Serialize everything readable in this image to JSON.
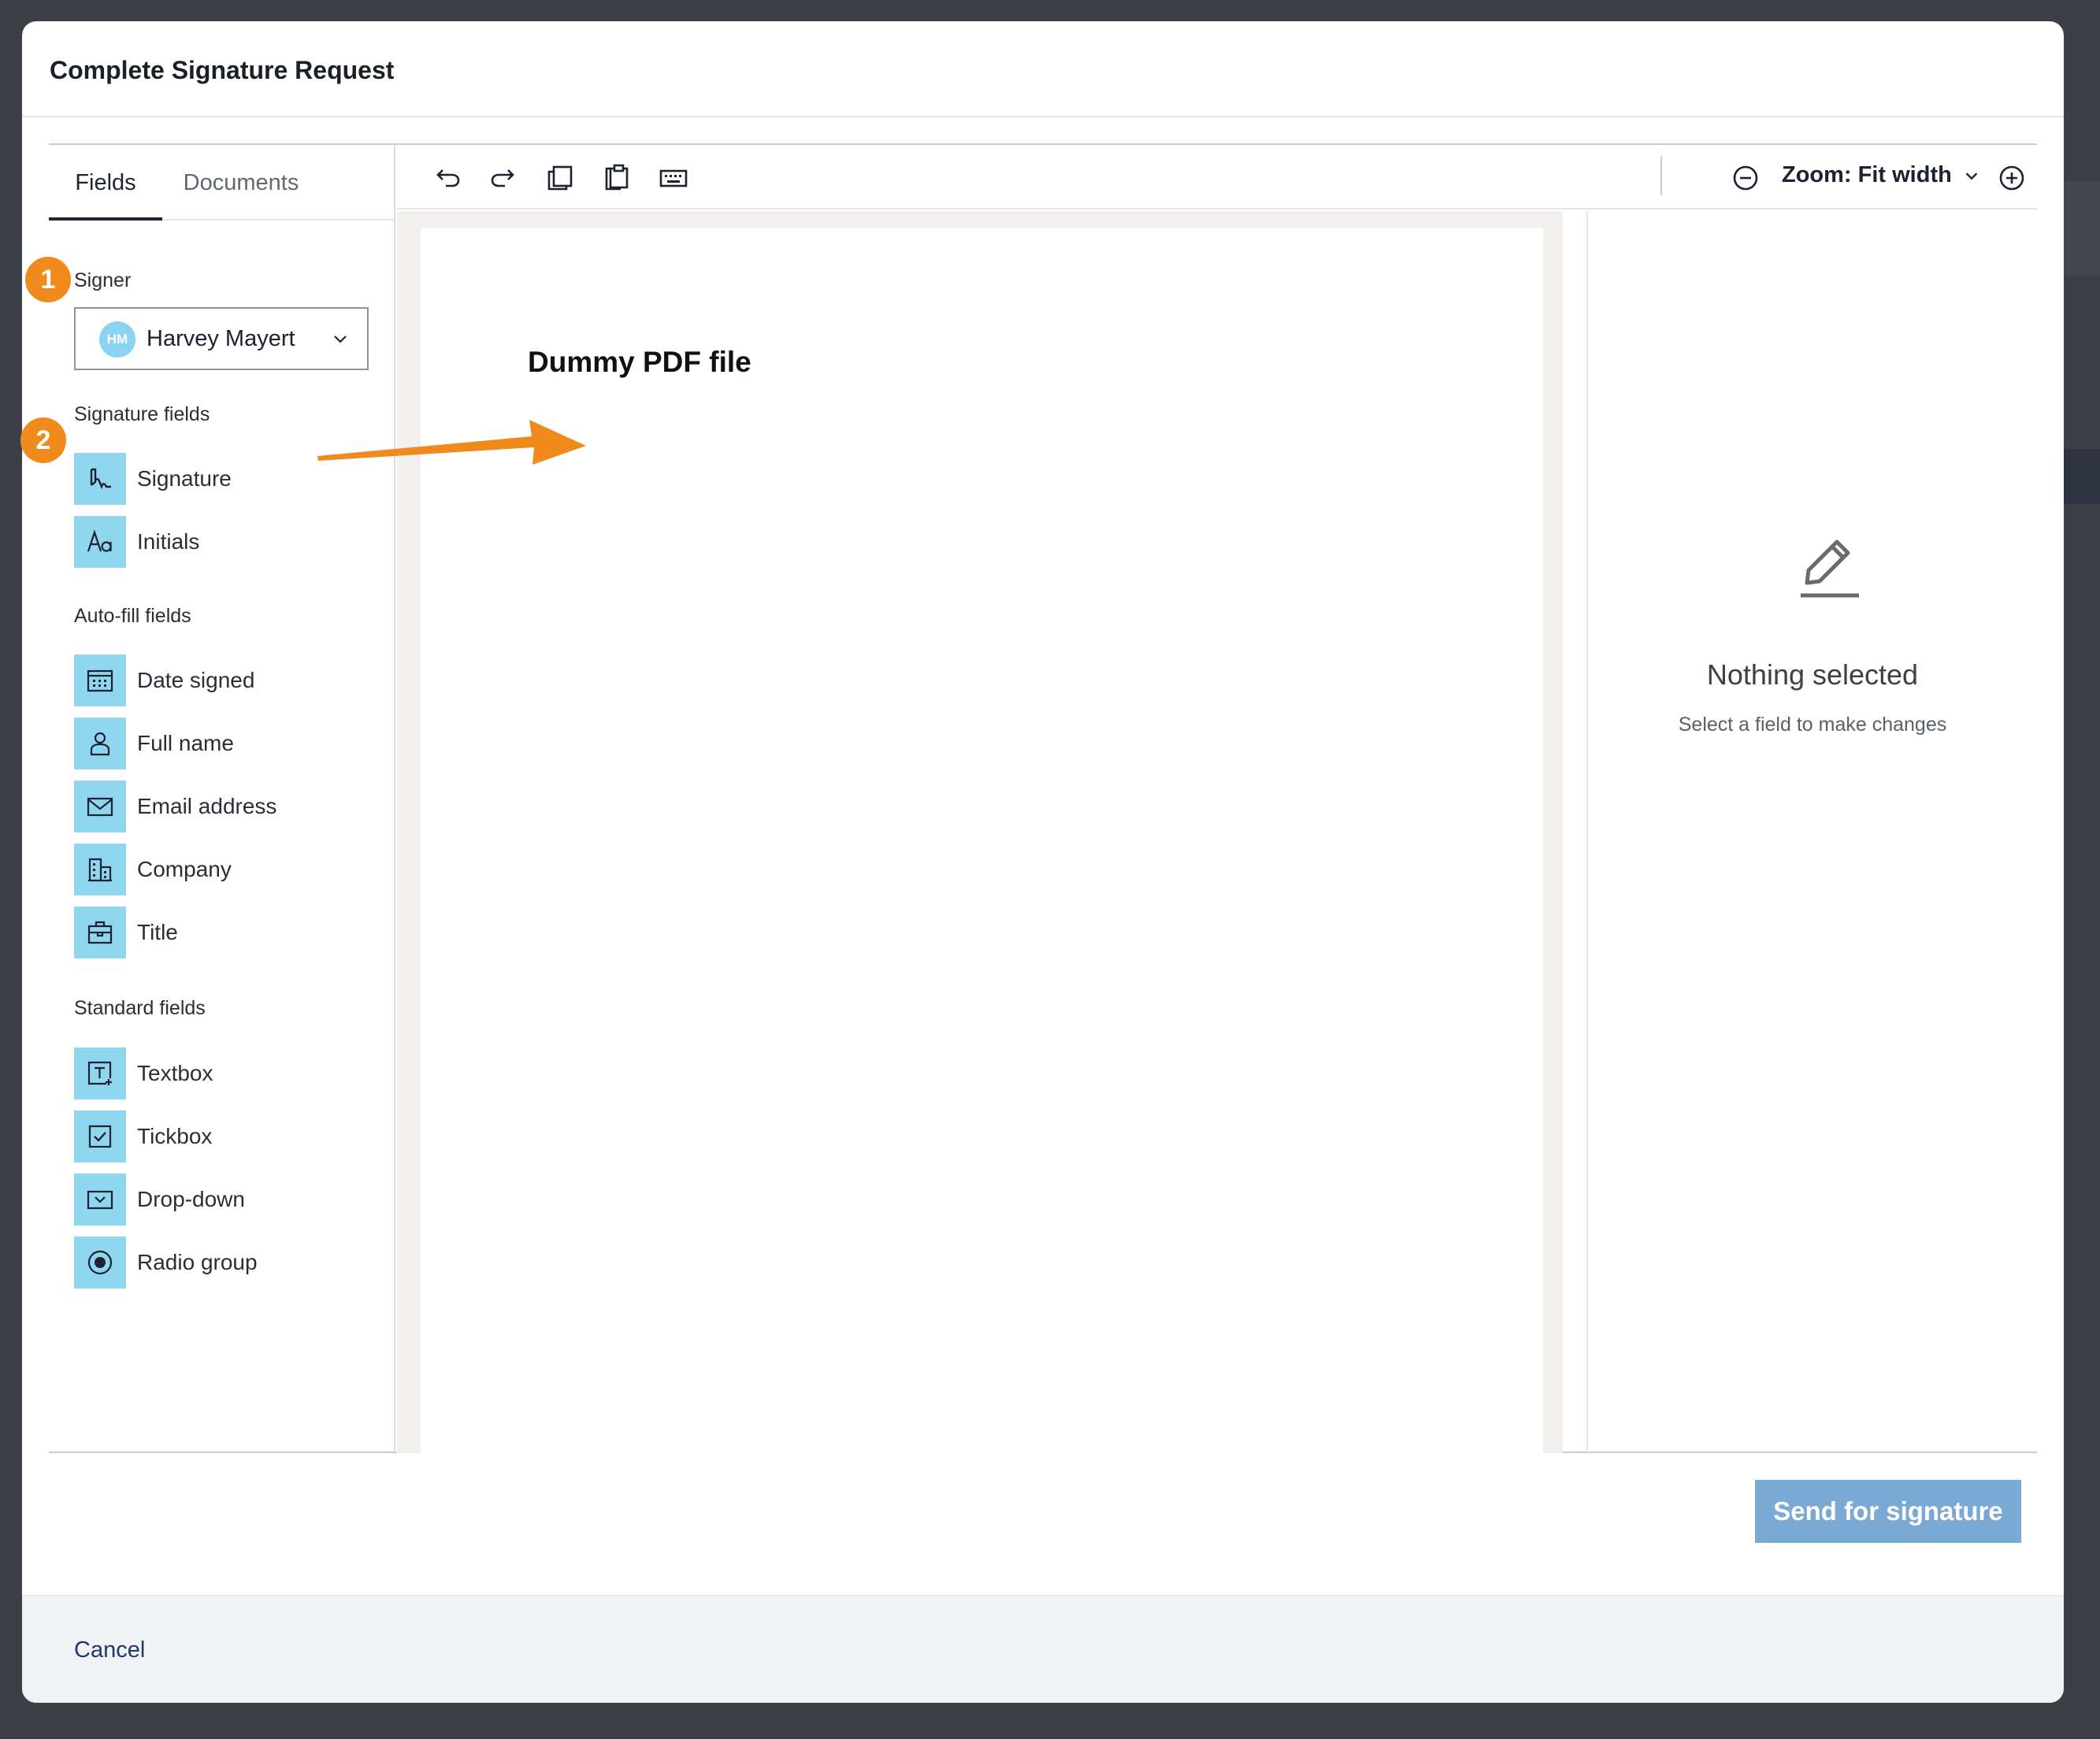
{
  "modal": {
    "title": "Complete Signature Request"
  },
  "tabs": [
    {
      "label": "Fields",
      "active": true
    },
    {
      "label": "Documents",
      "active": false
    }
  ],
  "signer": {
    "section_label": "Signer",
    "initials": "HM",
    "name": "Harvey Mayert"
  },
  "signature_fields": {
    "label": "Signature fields",
    "items": [
      {
        "label": "Signature",
        "icon": "signature-icon"
      },
      {
        "label": "Initials",
        "icon": "initials-icon"
      }
    ]
  },
  "autofill_fields": {
    "label": "Auto-fill fields",
    "items": [
      {
        "label": "Date signed",
        "icon": "calendar-icon"
      },
      {
        "label": "Full name",
        "icon": "person-icon"
      },
      {
        "label": "Email address",
        "icon": "envelope-icon"
      },
      {
        "label": "Company",
        "icon": "building-icon"
      },
      {
        "label": "Title",
        "icon": "briefcase-icon"
      }
    ]
  },
  "standard_fields": {
    "label": "Standard fields",
    "items": [
      {
        "label": "Textbox",
        "icon": "textbox-icon"
      },
      {
        "label": "Tickbox",
        "icon": "checkbox-icon"
      },
      {
        "label": "Drop-down",
        "icon": "dropdown-icon"
      },
      {
        "label": "Radio group",
        "icon": "radio-icon"
      }
    ]
  },
  "badges": [
    "1",
    "2"
  ],
  "toolbar": {
    "tools": [
      "undo-icon",
      "redo-icon",
      "copy-icon",
      "paste-icon",
      "keyboard-icon"
    ],
    "zoom_label": "Zoom: Fit width"
  },
  "document": {
    "title": "Dummy PDF file"
  },
  "properties": {
    "empty_title": "Nothing selected",
    "empty_subtitle": "Select a field to make changes"
  },
  "actions": {
    "send_label": "Send for signature",
    "cancel_label": "Cancel"
  },
  "colors": {
    "field_icon_bg": "#8fd6ef",
    "badge": "#f08a1c",
    "send_button": "#7aa9d4",
    "avatar": "#8ad4f2"
  }
}
